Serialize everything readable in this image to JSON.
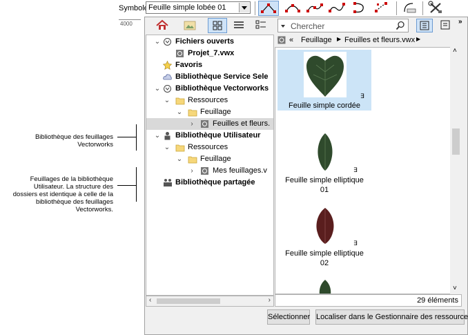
{
  "toolbar": {
    "symbol_label": "Symbole",
    "symbol_value": "Feuille simple lobée 01",
    "ruler_value": "4000",
    "tools": [
      "arc-point-icon",
      "arc-curve-icon",
      "double-arc-icon",
      "s-curve-icon",
      "spiral-curve-icon",
      "scatter-points-icon",
      "curve-fit-icon",
      "settings-tools-icon"
    ]
  },
  "search": {
    "placeholder": "Chercher"
  },
  "breadcrumb": {
    "prefix": "«",
    "items": [
      "Feuillage",
      "Feuilles et fleurs.vwx"
    ]
  },
  "tree": {
    "items": [
      {
        "label": "Fichiers ouverts",
        "bold": true
      },
      {
        "label": "Projet_7.vwx",
        "bold": true
      },
      {
        "label": "Favoris",
        "bold": true
      },
      {
        "label": "Bibliothèque Service Sele",
        "bold": true
      },
      {
        "label": "Bibliothèque Vectorworks",
        "bold": true
      },
      {
        "label": "Ressources",
        "bold": false
      },
      {
        "label": "Feuillage",
        "bold": false
      },
      {
        "label": "Feuilles et fleurs.",
        "bold": false
      },
      {
        "label": "Bibliothèque Utilisateur",
        "bold": true
      },
      {
        "label": "Ressources",
        "bold": false
      },
      {
        "label": "Feuillage",
        "bold": false
      },
      {
        "label": "Mes feuillages.v",
        "bold": false
      },
      {
        "label": "Bibliothèque partagée",
        "bold": true
      }
    ]
  },
  "resources": [
    {
      "name": "Feuille simple cordée",
      "selected": true
    },
    {
      "name": "Feuille simple elliptique 01",
      "selected": false
    },
    {
      "name": "Feuille simple elliptique 02",
      "selected": false
    }
  ],
  "resource_lines": {
    "r0": [
      "Feuille simple cordée"
    ],
    "r1": [
      "Feuille simple elliptique",
      "01"
    ],
    "r2": [
      "Feuille simple elliptique",
      "02"
    ]
  },
  "status": {
    "count": "29 éléments"
  },
  "buttons": {
    "select": "Sélectionner",
    "locate": "Localiser dans le Gestionnaire des ressources"
  },
  "annotations": {
    "a1": [
      "Bibliothèque des feuillages",
      "Vectorworks"
    ],
    "a2": [
      "Feuillages de la bibliothèque",
      "Utilisateur. La structure des",
      "dossiers est identique à celle de la",
      "bibliothèque des feuillages",
      "Vectorworks."
    ]
  },
  "colors": {
    "selection": "#cce4f7",
    "accent": "#6c9bd2",
    "leaf_dark": "#2f4a2c",
    "leaf_red": "#5a1e1e"
  }
}
